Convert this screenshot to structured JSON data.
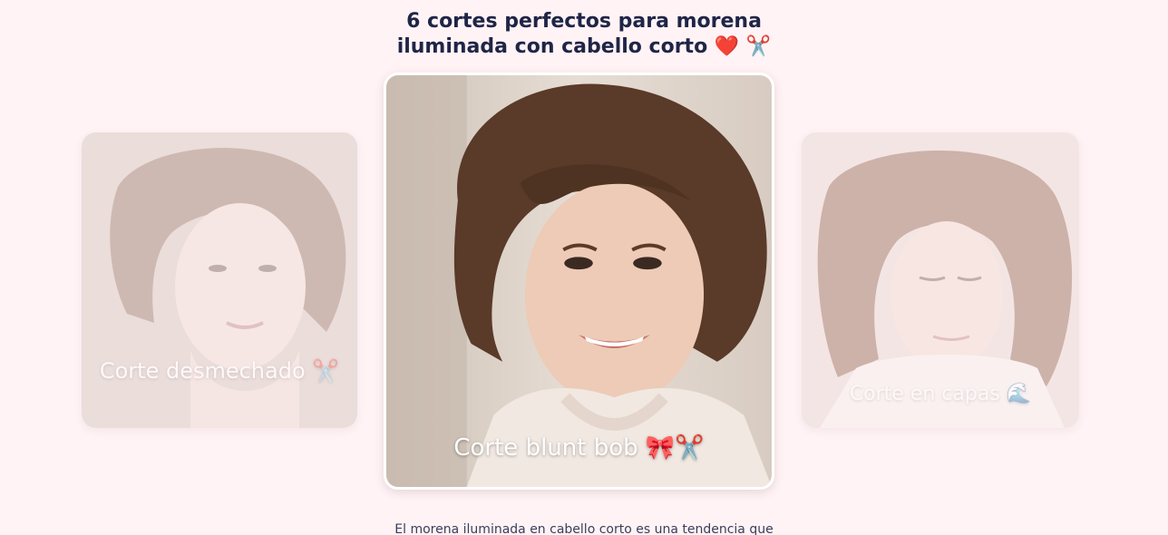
{
  "page": {
    "title_line1": "6 cortes perfectos para morena",
    "title_line2": "iluminada con cabello corto",
    "title_emoji": "❤️ ✂️",
    "intro_text": "El morena iluminada en cabello corto es una tendencia que"
  },
  "carousel": {
    "cards": [
      {
        "caption": "Corte desmechado ✂️",
        "image": "woman-short-messy-hair-photo"
      },
      {
        "caption": "Corte blunt bob 🎀✂️",
        "image": "woman-curly-bob-photo"
      },
      {
        "caption": "Corte en capas 🌊",
        "image": "woman-layered-hair-photo"
      }
    ]
  },
  "colors": {
    "background": "#fff3f5",
    "title": "#1f2547",
    "caption": "#ffffff",
    "text": "#3a3f5c"
  }
}
